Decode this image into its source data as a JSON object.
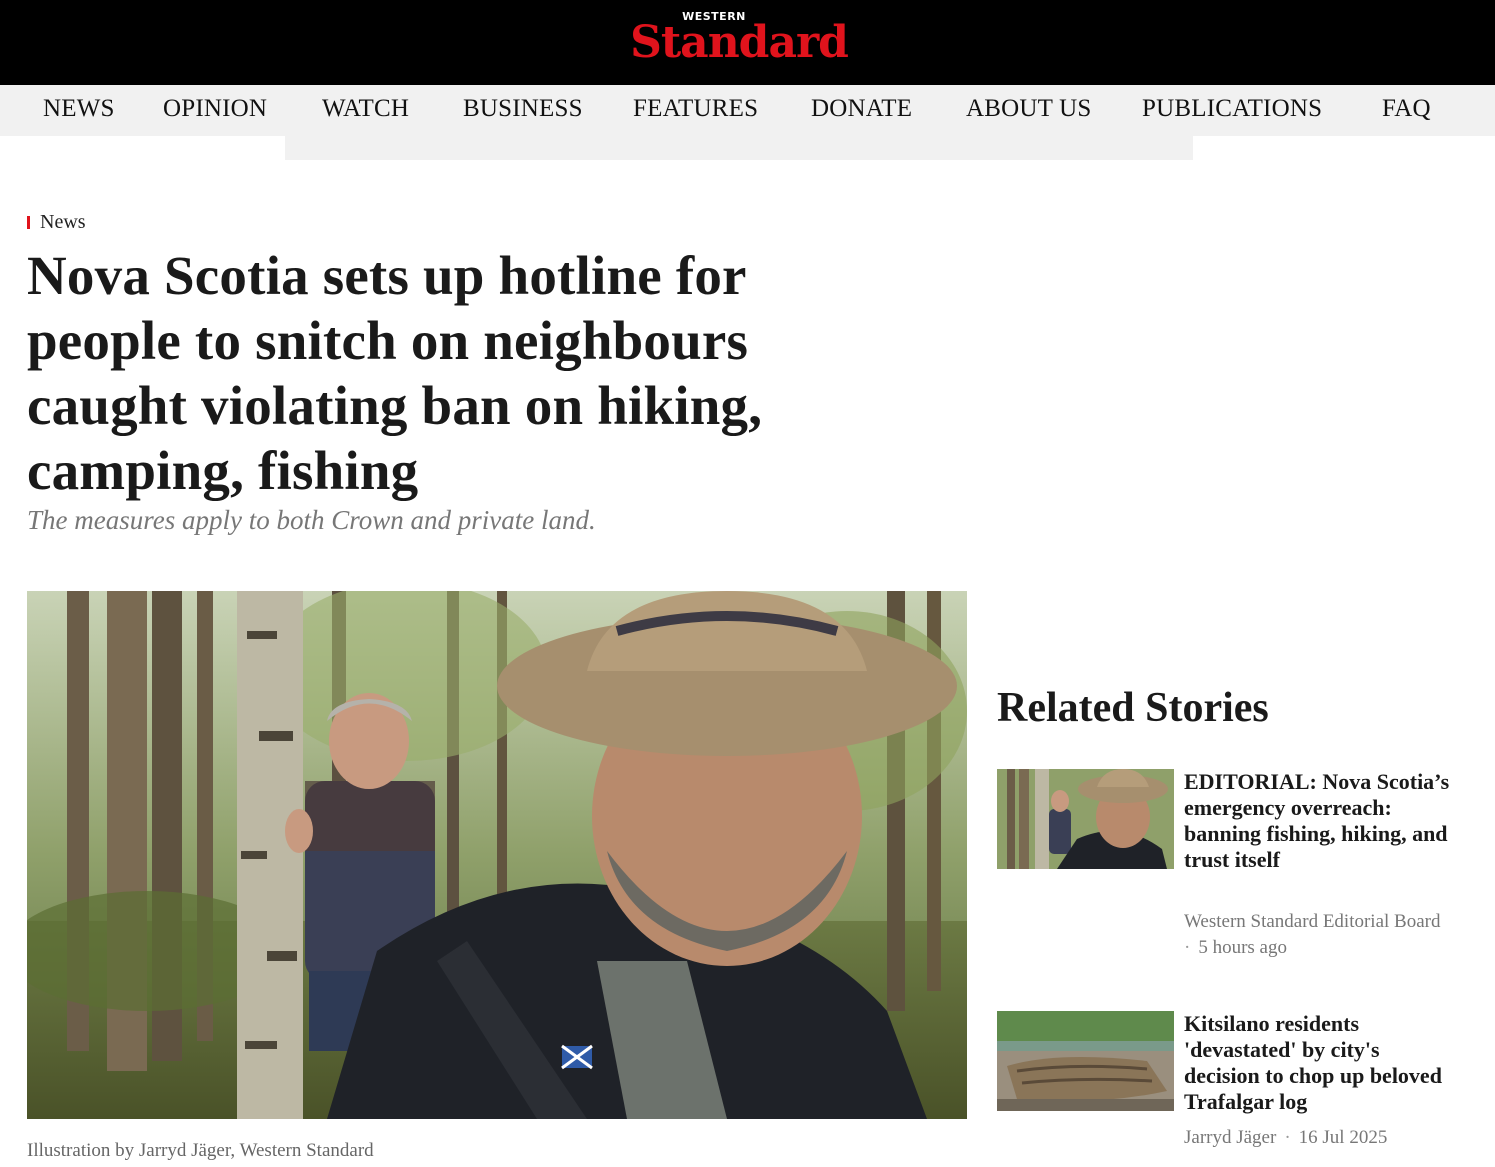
{
  "header": {
    "logo_small": "WESTERN",
    "logo_big": "Standard",
    "brand_color": "#e0131c"
  },
  "nav": {
    "items": [
      "NEWS",
      "OPINION",
      "WATCH",
      "BUSINESS",
      "FEATURES",
      "DONATE",
      "ABOUT US",
      "PUBLICATIONS",
      "FAQ"
    ]
  },
  "article": {
    "category": "News",
    "headline": "Nova Scotia sets up hotline for people to snitch on neighbours caught violating ban on hiking, camping, fishing",
    "subhead": "The measures apply to both Crown and private land.",
    "caption": "Illustration by Jarryd Jäger, Western Standard"
  },
  "related": {
    "title": "Related Stories",
    "stories": [
      {
        "headline": "EDITORIAL: Nova Scotia’s emergency overreach: banning fishing, hiking, and trust itself",
        "author": "Western Standard Editorial Board",
        "time": "5 hours ago"
      },
      {
        "headline": "Kitsilano residents 'devastated' by city's decision to chop up beloved Trafalgar log",
        "author": "Jarryd Jäger",
        "time": "16 Jul 2025"
      }
    ]
  }
}
